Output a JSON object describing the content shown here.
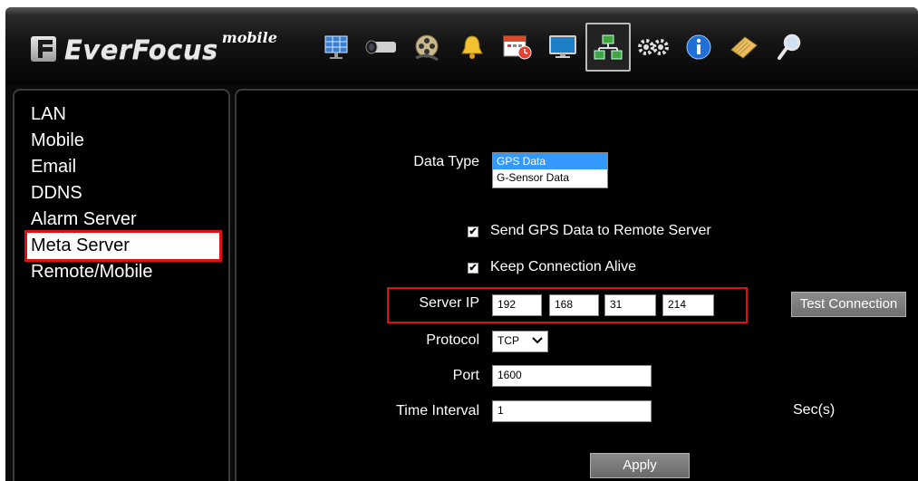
{
  "app": {
    "brand": "EverFocus",
    "brand_suffix": "mobile"
  },
  "toolbar": {
    "icons": [
      "layout-grid-icon",
      "camera-icon",
      "film-reel-icon",
      "alarm-bell-icon",
      "calendar-clock-icon",
      "monitor-icon",
      "network-icon",
      "settings-gears-icon",
      "info-icon",
      "notepad-icon",
      "search-icon"
    ],
    "selected": "network-icon"
  },
  "sidebar": {
    "items": [
      {
        "label": "LAN"
      },
      {
        "label": "Mobile"
      },
      {
        "label": "Email"
      },
      {
        "label": "DDNS"
      },
      {
        "label": "Alarm Server"
      },
      {
        "label": "Meta Server"
      },
      {
        "label": "Remote/Mobile"
      }
    ],
    "active": "Meta Server"
  },
  "form": {
    "data_type": {
      "label": "Data Type",
      "options": [
        "GPS Data",
        "G-Sensor Data"
      ],
      "selected": "GPS Data"
    },
    "send_gps": {
      "label": "Send GPS Data to Remote Server",
      "checked": true
    },
    "keep_alive": {
      "label": "Keep Connection Alive",
      "checked": true
    },
    "server_ip": {
      "label": "Server IP",
      "octets": [
        "192",
        "168",
        "31",
        "214"
      ]
    },
    "test_button": "Test Connection",
    "protocol": {
      "label": "Protocol",
      "value": "TCP"
    },
    "port": {
      "label": "Port",
      "value": "1600"
    },
    "time_interval": {
      "label": "Time Interval",
      "value": "1",
      "unit": "Sec(s)"
    },
    "apply_button": "Apply"
  },
  "colors": {
    "highlight": "#e01010",
    "selection": "#3399ff",
    "background": "#000000"
  }
}
